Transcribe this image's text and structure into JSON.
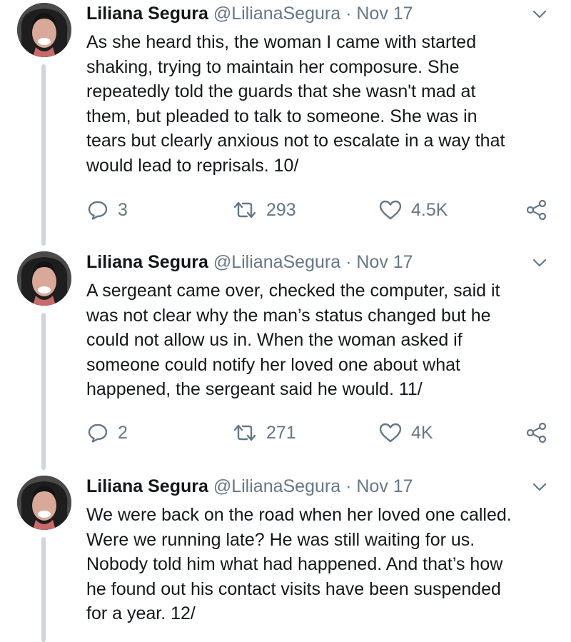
{
  "tweets": [
    {
      "name": "Liliana Segura",
      "handle": "@LilianaSegura",
      "separator": "·",
      "date": "Nov 17",
      "lines": [
        "As she heard this, the woman I came with started",
        "shaking, trying to maintain her composure. She",
        "repeatedly told the guards that she wasn't mad at",
        "them, but pleaded to talk to someone. She was in",
        "tears but clearly anxious not to escalate in a way that",
        "would lead to reprisals. 10/"
      ],
      "replies": "3",
      "retweets": "293",
      "likes": "4.5K"
    },
    {
      "name": "Liliana Segura",
      "handle": "@LilianaSegura",
      "separator": "·",
      "date": "Nov 17",
      "lines": [
        "A sergeant came over, checked the computer, said it",
        "was not clear why the man’s status changed but he",
        "could not allow us in. When the woman asked if",
        "someone could notify her loved one about what",
        "happened, the sergeant said he would. 11/"
      ],
      "replies": "2",
      "retweets": "271",
      "likes": "4K"
    },
    {
      "name": "Liliana Segura",
      "handle": "@LilianaSegura",
      "separator": "·",
      "date": "Nov 17",
      "lines": [
        "We were back on the road when her loved one called.",
        "Were we running late? He was still waiting for us.",
        "Nobody told him what had happened. And that’s how",
        "he found out his contact visits have been suspended",
        "for a year. 12/"
      ],
      "replies": "",
      "retweets": "",
      "likes": ""
    }
  ],
  "icons": {
    "reply": "reply-icon",
    "retweet": "retweet-icon",
    "like": "like-icon",
    "share": "share-icon",
    "menu": "chevron-down-icon"
  },
  "colors": {
    "text": "#14171a",
    "secondary": "#657786",
    "thread_line": "#cdd6dd"
  }
}
